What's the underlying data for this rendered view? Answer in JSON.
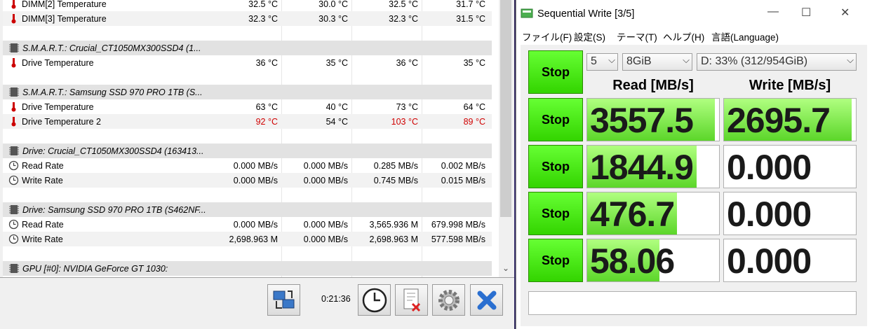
{
  "hwinfo": {
    "rows": [
      {
        "kind": "row",
        "label": "DIMM[2] Temperature",
        "icon": "thermometer-icon",
        "v": [
          "32.5 °C",
          "30.0 °C",
          "32.5 °C",
          "31.7 °C"
        ],
        "red": [
          false,
          false,
          false,
          false
        ]
      },
      {
        "kind": "row",
        "label": "DIMM[3] Temperature",
        "icon": "thermometer-icon",
        "v": [
          "32.3 °C",
          "30.3 °C",
          "32.3 °C",
          "31.5 °C"
        ],
        "red": [
          false,
          false,
          false,
          false
        ]
      },
      {
        "kind": "blank"
      },
      {
        "kind": "group",
        "label": "S.M.A.R.T.: Crucial_CT1050MX300SSD4 (1...",
        "icon": "drive-chip-icon"
      },
      {
        "kind": "row",
        "label": "Drive Temperature",
        "icon": "thermometer-icon",
        "v": [
          "36 °C",
          "35 °C",
          "36 °C",
          "35 °C"
        ],
        "red": [
          false,
          false,
          false,
          false
        ]
      },
      {
        "kind": "blank"
      },
      {
        "kind": "group",
        "label": "S.M.A.R.T.: Samsung SSD 970 PRO 1TB (S...",
        "icon": "drive-chip-icon"
      },
      {
        "kind": "row",
        "label": "Drive Temperature",
        "icon": "thermometer-icon",
        "v": [
          "63 °C",
          "40 °C",
          "73 °C",
          "64 °C"
        ],
        "red": [
          false,
          false,
          false,
          false
        ]
      },
      {
        "kind": "row",
        "label": "Drive Temperature 2",
        "icon": "thermometer-icon",
        "v": [
          "92 °C",
          "54 °C",
          "103 °C",
          "89 °C"
        ],
        "red": [
          true,
          false,
          true,
          true
        ]
      },
      {
        "kind": "blank"
      },
      {
        "kind": "group",
        "label": "Drive: Crucial_CT1050MX300SSD4 (163413...",
        "icon": "drive-chip-icon"
      },
      {
        "kind": "row",
        "label": "Read Rate",
        "icon": "clock-gauge-icon",
        "v": [
          "0.000 MB/s",
          "0.000 MB/s",
          "0.285 MB/s",
          "0.002 MB/s"
        ],
        "red": [
          false,
          false,
          false,
          false
        ]
      },
      {
        "kind": "row",
        "label": "Write Rate",
        "icon": "clock-gauge-icon",
        "v": [
          "0.000 MB/s",
          "0.000 MB/s",
          "0.745 MB/s",
          "0.015 MB/s"
        ],
        "red": [
          false,
          false,
          false,
          false
        ]
      },
      {
        "kind": "blank"
      },
      {
        "kind": "group",
        "label": "Drive: Samsung SSD 970 PRO 1TB (S462NF...",
        "icon": "drive-chip-icon"
      },
      {
        "kind": "row",
        "label": "Read Rate",
        "icon": "clock-gauge-icon",
        "v": [
          "0.000 MB/s",
          "0.000 MB/s",
          "3,565.936 M",
          "679.998 MB/s"
        ],
        "red": [
          false,
          false,
          false,
          false
        ]
      },
      {
        "kind": "row",
        "label": "Write Rate",
        "icon": "clock-gauge-icon",
        "v": [
          "2,698.963 M",
          "0.000 MB/s",
          "2,698.963 M",
          "577.598 MB/s"
        ],
        "red": [
          false,
          false,
          false,
          false
        ]
      },
      {
        "kind": "blank"
      },
      {
        "kind": "group",
        "label": "GPU [#0]: NVIDIA GeForce GT 1030:",
        "icon": "drive-chip-icon"
      }
    ],
    "timer": "0:21:36",
    "colors": {
      "alarm": "#d00000"
    }
  },
  "cdm": {
    "title": "Sequential Write [3/5]",
    "menu": [
      "ファイル(F)",
      "設定(S)",
      "テーマ(T)",
      "ヘルプ(H)",
      "言語(Language)"
    ],
    "count": "5",
    "size": "8GiB",
    "drive": "D: 33% (312/954GiB)",
    "all_button": "Stop",
    "read_header": "Read [MB/s]",
    "write_header": "Write [MB/s]",
    "tests": [
      {
        "button": "Stop",
        "read": "3557.5",
        "write": "2695.7",
        "read_fill": 0.97,
        "write_fill": 0.97
      },
      {
        "button": "Stop",
        "read": "1844.9",
        "write": "0.000",
        "read_fill": 0.83,
        "write_fill": 0
      },
      {
        "button": "Stop",
        "read": "476.7",
        "write": "0.000",
        "read_fill": 0.68,
        "write_fill": 0
      },
      {
        "button": "Stop",
        "read": "58.06",
        "write": "0.000",
        "read_fill": 0.55,
        "write_fill": 0
      }
    ],
    "status": "",
    "colors": {
      "button_green": "#44dd11",
      "bar_green": "#6fdc3a"
    }
  }
}
